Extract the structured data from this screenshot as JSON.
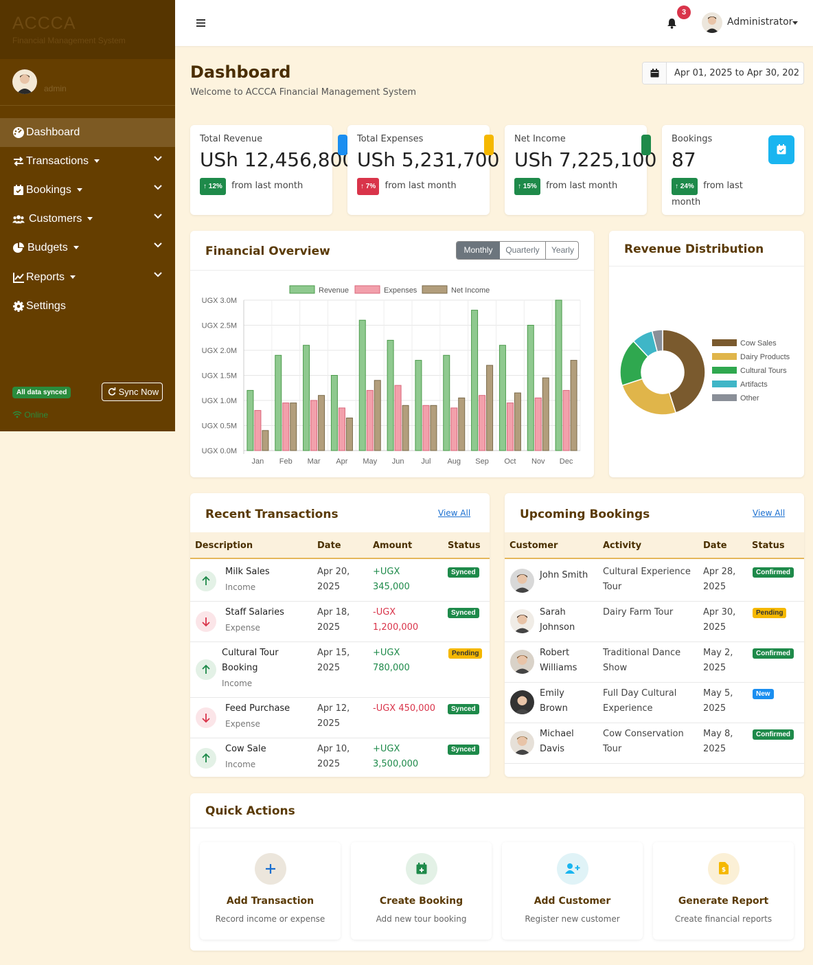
{
  "sidebar": {
    "brand": "ACCCA",
    "brand_sub": "Financial Management System",
    "user_name": "admin",
    "items": [
      {
        "label": "Dashboard",
        "icon": "dashboard-icon"
      },
      {
        "label": "Transactions",
        "icon": "exchange-icon"
      },
      {
        "label": "Bookings",
        "icon": "calendar-check-icon"
      },
      {
        "label": "Customers",
        "icon": "users-icon"
      },
      {
        "label": "Budgets",
        "icon": "pie-chart-icon"
      },
      {
        "label": "Reports",
        "icon": "line-chart-icon"
      },
      {
        "label": "Settings",
        "icon": "gear-icon"
      }
    ],
    "sync_status": "All data synced",
    "sync_button": "Sync Now",
    "online": "Online"
  },
  "topbar": {
    "notification_count": "3",
    "user_menu": "Administrator"
  },
  "page": {
    "title": "Dashboard",
    "subtitle": "Welcome to ACCCA Financial Management System",
    "date_range": "Apr 01, 2025 to Apr 30, 202"
  },
  "stats": [
    {
      "label": "Total Revenue",
      "value": "USh 12,456,800",
      "change": "12%",
      "change_text": "from last month",
      "direction": "up",
      "color": "#1e8a4a",
      "icon_color": "#1a8ef0"
    },
    {
      "label": "Total Expenses",
      "value": "USh 5,231,700",
      "change": "7%",
      "change_text": "from last month",
      "direction": "up",
      "color": "#d9344a",
      "icon_color": "#f5b800"
    },
    {
      "label": "Net Income",
      "value": "USh 7,225,100",
      "change": "15%",
      "change_text": "from last month",
      "direction": "up",
      "color": "#1e8a4a",
      "icon_color": "#1e8a4a"
    },
    {
      "label": "Bookings",
      "value": "87",
      "change": "24%",
      "change_text": "from last month",
      "direction": "up",
      "color": "#1e8a4a",
      "icon_color": "#19b5f0"
    }
  ],
  "financial_overview": {
    "title": "Financial Overview",
    "tabs": [
      "Monthly",
      "Quarterly",
      "Yearly"
    ],
    "active_tab": "Monthly"
  },
  "revenue_distribution": {
    "title": "Revenue Distribution"
  },
  "chart_data": [
    {
      "type": "bar",
      "categories": [
        "Jan",
        "Feb",
        "Mar",
        "Apr",
        "May",
        "Jun",
        "Jul",
        "Aug",
        "Sep",
        "Oct",
        "Nov",
        "Dec"
      ],
      "series": [
        {
          "name": "Revenue",
          "color": "#8fc98f",
          "values": [
            1200000,
            1900000,
            2100000,
            1500000,
            2600000,
            2200000,
            1800000,
            1900000,
            2800000,
            2100000,
            2500000,
            3000000
          ]
        },
        {
          "name": "Expenses",
          "color": "#f2a0ab",
          "values": [
            800000,
            950000,
            1000000,
            850000,
            1200000,
            1300000,
            900000,
            850000,
            1100000,
            950000,
            1050000,
            1200000
          ]
        },
        {
          "name": "Net Income",
          "color": "#b29e7c",
          "values": [
            400000,
            950000,
            1100000,
            650000,
            1400000,
            900000,
            900000,
            1050000,
            1700000,
            1150000,
            1450000,
            1800000
          ]
        }
      ],
      "yticks": [
        "UGX 0.0M",
        "UGX 0.5M",
        "UGX 1.0M",
        "UGX 1.5M",
        "UGX 2.0M",
        "UGX 2.5M",
        "UGX 3.0M"
      ],
      "ylim": [
        0,
        3000000
      ],
      "grid": true,
      "legend": "top"
    },
    {
      "type": "pie",
      "style": "doughnut",
      "labels": [
        "Cow Sales",
        "Dairy Products",
        "Cultural Tours",
        "Artifacts",
        "Other"
      ],
      "values": [
        45,
        25,
        18,
        8,
        4
      ],
      "colors": [
        "#7a5a2e",
        "#e0b54a",
        "#2fa84f",
        "#3fb6c7",
        "#8a8f98"
      ],
      "legend": "right"
    }
  ],
  "recent_transactions": {
    "title": "Recent Transactions",
    "view_all": "View All",
    "columns": [
      "Description",
      "Date",
      "Amount",
      "Status"
    ],
    "rows": [
      {
        "desc": "Milk Sales",
        "type": "Income",
        "date1": "Apr 20,",
        "date2": "2025",
        "amount1": "+UGX",
        "amount2": "345,000",
        "status": "Synced",
        "dir": "up"
      },
      {
        "desc": "Staff Salaries",
        "type": "Expense",
        "date1": "Apr 18,",
        "date2": "2025",
        "amount1": "-UGX",
        "amount2": "1,200,000",
        "status": "Synced",
        "dir": "down"
      },
      {
        "desc": "Cultural Tour",
        "desc2": "Booking",
        "type": "Income",
        "date1": "Apr 15,",
        "date2": "2025",
        "amount1": "+UGX",
        "amount2": "780,000",
        "status": "Pending",
        "dir": "up"
      },
      {
        "desc": "Feed Purchase",
        "type": "Expense",
        "date1": "Apr 12,",
        "date2": "2025",
        "amount1": "-UGX 450,000",
        "amount2": "",
        "status": "Synced",
        "dir": "down"
      },
      {
        "desc": "Cow Sale",
        "type": "Income",
        "date1": "Apr 10,",
        "date2": "2025",
        "amount1": "+UGX",
        "amount2": "3,500,000",
        "status": "Synced",
        "dir": "up"
      }
    ]
  },
  "upcoming_bookings": {
    "title": "Upcoming Bookings",
    "view_all": "View All",
    "columns": [
      "Customer",
      "Activity",
      "Date",
      "Status"
    ],
    "rows": [
      {
        "name1": "John Smith",
        "name2": "",
        "act1": "Cultural Experience",
        "act2": "Tour",
        "date1": "Apr 28,",
        "date2": "2025",
        "status": "Confirmed"
      },
      {
        "name1": "Sarah",
        "name2": "Johnson",
        "act1": "Dairy Farm Tour",
        "act2": "",
        "date1": "Apr 30,",
        "date2": "2025",
        "status": "Pending"
      },
      {
        "name1": "Robert",
        "name2": "Williams",
        "act1": "Traditional Dance",
        "act2": "Show",
        "date1": "May 2,",
        "date2": "2025",
        "status": "Confirmed"
      },
      {
        "name1": "Emily",
        "name2": "Brown",
        "act1": "Full Day Cultural",
        "act2": "Experience",
        "date1": "May 5,",
        "date2": "2025",
        "status": "New"
      },
      {
        "name1": "Michael",
        "name2": "Davis",
        "act1": "Cow Conservation",
        "act2": "Tour",
        "date1": "May 8,",
        "date2": "2025",
        "status": "Confirmed"
      }
    ]
  },
  "quick_actions": {
    "title": "Quick Actions",
    "items": [
      {
        "title": "Add Transaction",
        "desc": "Record income or expense",
        "icon": "plus-icon"
      },
      {
        "title": "Create Booking",
        "desc": "Add new tour booking",
        "icon": "calendar-plus-icon"
      },
      {
        "title": "Add Customer",
        "desc": "Register new customer",
        "icon": "user-plus-icon"
      },
      {
        "title": "Generate Report",
        "desc": "Create financial reports",
        "icon": "file-invoice-icon"
      }
    ]
  }
}
